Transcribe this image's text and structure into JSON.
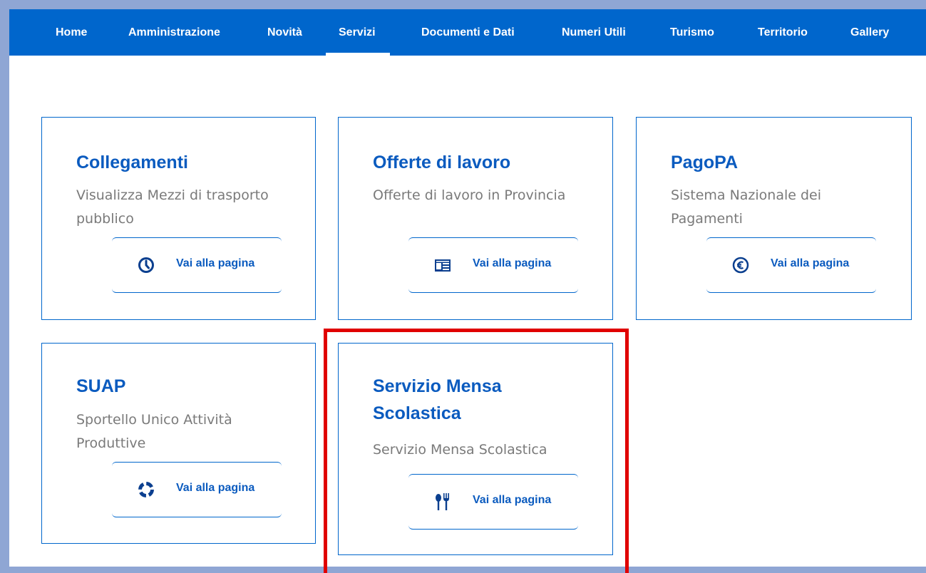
{
  "nav": {
    "items": [
      {
        "label": "Home"
      },
      {
        "label": "Amministrazione"
      },
      {
        "label": "Novità"
      },
      {
        "label": "Servizi",
        "active": true
      },
      {
        "label": "Documenti e Dati"
      },
      {
        "label": "Numeri Utili"
      },
      {
        "label": "Turismo"
      },
      {
        "label": "Territorio"
      },
      {
        "label": "Gallery"
      }
    ]
  },
  "cards": [
    {
      "title": "Collegamenti",
      "description": "Visualizza Mezzi di trasporto pubblico",
      "link_label": "Vai alla pagina",
      "icon": "clock-icon"
    },
    {
      "title": "Offerte di lavoro",
      "description": "Offerte di lavoro in Provincia",
      "link_label": "Vai alla pagina",
      "icon": "newspaper-icon"
    },
    {
      "title": "PagoPA",
      "description": "Sistema Nazionale dei Pagamenti",
      "link_label": "Vai alla pagina",
      "icon": "euro-icon"
    },
    {
      "title": "SUAP",
      "description": "Sportello Unico Attività Produttive",
      "link_label": "Vai alla pagina",
      "icon": "lifebuoy-icon"
    },
    {
      "title": "Servizio Mensa Scolastica",
      "description": "Servizio Mensa Scolastica",
      "link_label": "Vai alla pagina",
      "icon": "cutlery-icon"
    }
  ],
  "colors": {
    "nav_background": "#0066cc",
    "card_border": "#0066cc",
    "title_color": "#0b5bbf",
    "description_color": "#7a7a7a",
    "highlight": "#e00000",
    "frame": "#8fa6d4"
  }
}
